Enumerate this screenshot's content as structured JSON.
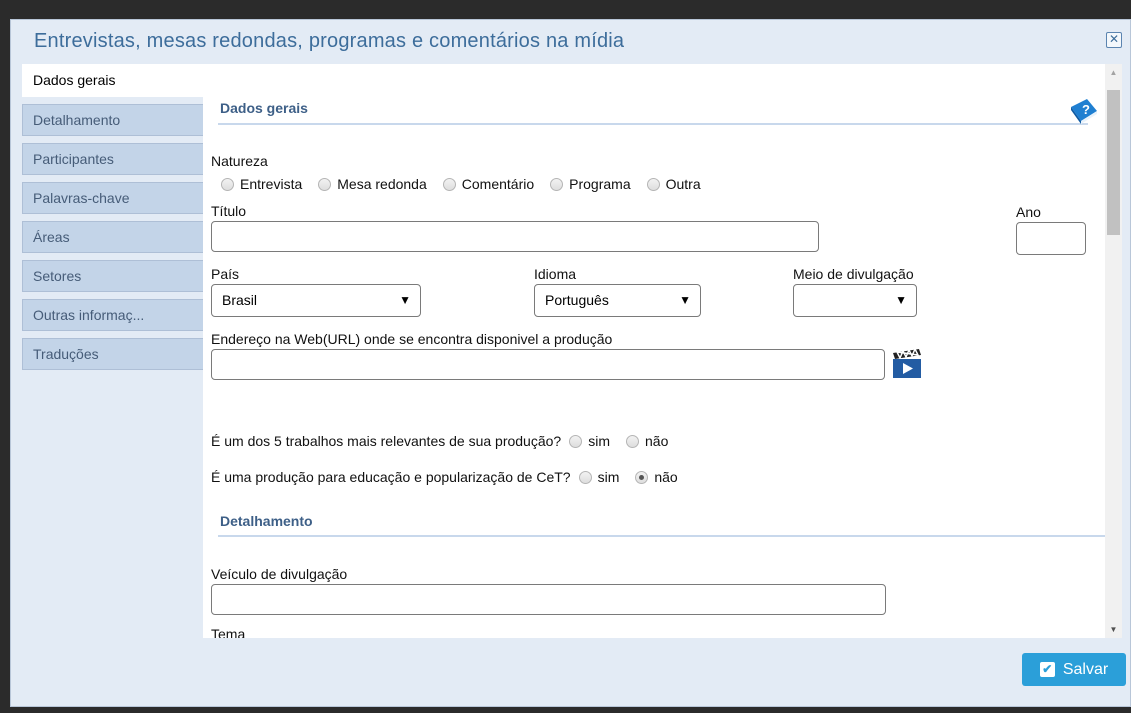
{
  "dialog": {
    "title": "Entrevistas, mesas redondas, programas e comentários na mídia",
    "close_icon": "close-x-icon"
  },
  "tabs": [
    {
      "label": "Dados gerais",
      "active": true
    },
    {
      "label": "Detalhamento",
      "active": false
    },
    {
      "label": "Participantes",
      "active": false
    },
    {
      "label": "Palavras-chave",
      "active": false
    },
    {
      "label": "Áreas",
      "active": false
    },
    {
      "label": "Setores",
      "active": false
    },
    {
      "label": "Outras informaç...",
      "active": false
    },
    {
      "label": "Traduções",
      "active": false
    }
  ],
  "dados_gerais": {
    "heading": "Dados gerais",
    "natureza_label": "Natureza",
    "natureza_options": [
      "Entrevista",
      "Mesa redonda",
      "Comentário",
      "Programa",
      "Outra"
    ],
    "titulo_label": "Título",
    "titulo_value": "",
    "ano_label": "Ano",
    "ano_value": "",
    "pais_label": "País",
    "pais_value": "Brasil",
    "idioma_label": "Idioma",
    "idioma_value": "Português",
    "meio_label": "Meio de divulgação",
    "meio_value": "",
    "url_label": "Endereço na Web(URL) onde se encontra disponivel a produção",
    "url_value": "",
    "relevante_label": "É um dos 5 trabalhos mais relevantes de sua produção?",
    "relevante_sim": "sim",
    "relevante_nao": "não",
    "cet_label": "É uma produção para educação e popularização de CeT?",
    "cet_sim": "sim",
    "cet_nao": "não",
    "cet_selected": "não"
  },
  "detalhamento": {
    "heading": "Detalhamento",
    "veiculo_label": "Veículo de divulgação",
    "veiculo_value": "",
    "tema_label": "Tema",
    "tema_value": ""
  },
  "footer": {
    "save_label": "Salvar"
  },
  "colors": {
    "accent": "#2b9fd9",
    "title": "#3d6d9b",
    "tab_bg": "#c3d4e8",
    "dialog_bg": "#e3ebf5"
  }
}
